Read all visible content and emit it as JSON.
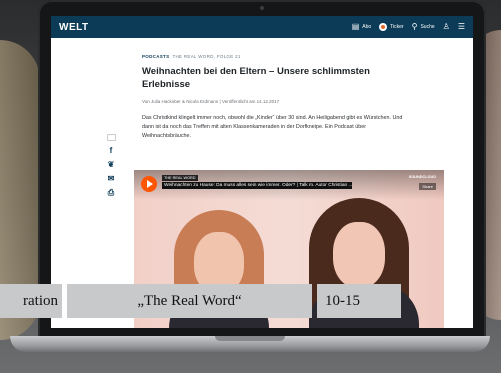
{
  "header": {
    "logo": "WELT",
    "abo": "Abo",
    "ticker": "Ticker",
    "search": "Suche"
  },
  "article": {
    "kicker_label": "PODCASTS",
    "kicker_series": "THE REAL WORD, FOLGE 21",
    "headline": "Weihnachten bei den Eltern – Unsere schlimmsten Erlebnisse",
    "byline": "Von Julia Hackober & Nicola Erdmann | Veröffentlicht am 14.12.2017",
    "teaser": "Das Christkind klingelt immer noch, obwohl die „Kinder“ über 30 sind. An Heiligabend gibt es Würstchen. Und dann ist da noch das Treffen mit alten Klassenkameraden in der Dorfkneipe. Ein Podcast über Weihnachtsbräuche."
  },
  "player": {
    "artist": "THE REAL WORD",
    "title": "Weihnachten zu Hause: Da muss alles sein wie immer. Oder? | Talk m. Autor Christian ...",
    "brand": "SOUNDCLOUD",
    "share": "Share"
  },
  "caption": {
    "left": "ration",
    "center": "„The Real Word“",
    "right": "10-15"
  },
  "colors": {
    "welt_blue": "#0b3b57",
    "soundcloud_orange": "#ff5500",
    "caption_gray": "#c8c9cb"
  }
}
